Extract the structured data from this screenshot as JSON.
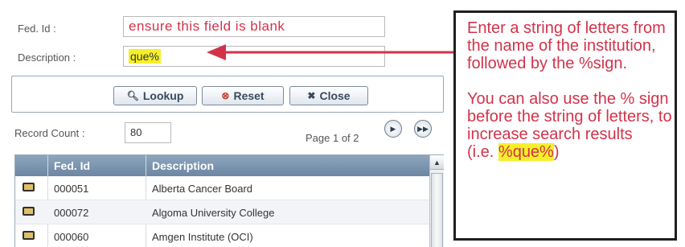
{
  "form": {
    "fed_id_label": "Fed. Id :",
    "fed_id_value": "ensure this field is blank",
    "description_label": "Description :",
    "description_value": "que%"
  },
  "buttons": {
    "lookup": "Lookup",
    "reset": "Reset",
    "close": "Close"
  },
  "record": {
    "count_label": "Record Count :",
    "count_value": "80",
    "page_text": "Page 1 of 2"
  },
  "grid": {
    "columns": [
      "Fed. Id",
      "Description"
    ],
    "rows": [
      {
        "id": "000051",
        "description": "Alberta Cancer Board"
      },
      {
        "id": "000072",
        "description": "Algoma University College"
      },
      {
        "id": "000060",
        "description": "Amgen Institute (OCI)"
      }
    ]
  },
  "callout": {
    "para1": "Enter a string of letters from the name of the institution, followed by the %sign.",
    "para2_prefix": "You can also use the % sign before the string of letters, to increase search results",
    "para2_open": "(i.e. ",
    "para2_highlight": "%que%",
    "para2_close": ")"
  },
  "colors": {
    "annotation_red": "#d2334a",
    "highlight_yellow": "#f5ef2a",
    "grid_header": "#7d97b1"
  },
  "icons": {
    "lookup": "magnifier-icon",
    "reset": "reset-circle-icon",
    "close": "close-x-icon",
    "next": "next-page-icon",
    "last": "last-page-icon"
  }
}
